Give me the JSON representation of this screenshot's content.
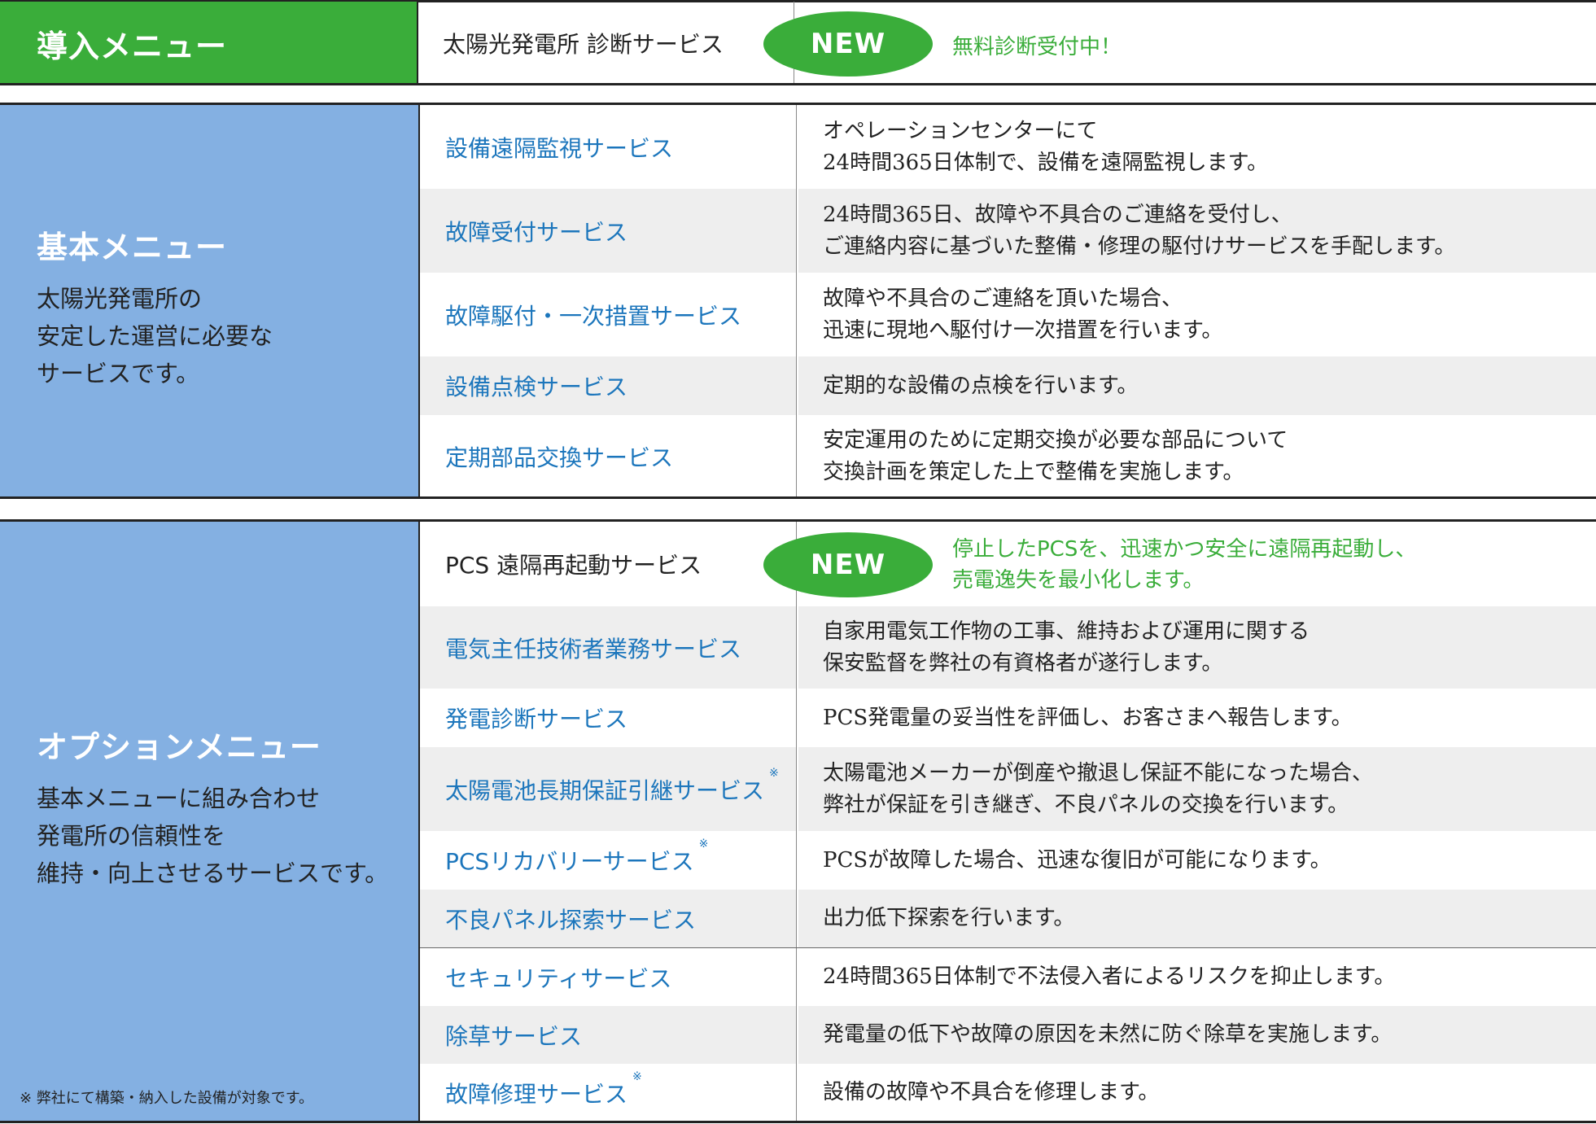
{
  "intro": {
    "label": "導入メニュー",
    "service": "太陽光発電所 診断サービス",
    "badge": "NEW",
    "note": "無料診断受付中！"
  },
  "basic": {
    "title": "基本メニュー",
    "desc": [
      "太陽光発電所の",
      "安定した運営に必要な",
      "サービスです。"
    ],
    "rows": [
      {
        "name": "設備遠隔監視サービス",
        "desc": [
          "オペレーションセンターにて",
          "24時間365日体制で、設備を遠隔監視します。"
        ]
      },
      {
        "name": "故障受付サービス",
        "desc": [
          "24時間365日、故障や不具合のご連絡を受付し、",
          "ご連絡内容に基づいた整備・修理の駆付けサービスを手配します。"
        ]
      },
      {
        "name": "故障駆付・一次措置サービス",
        "desc": [
          "故障や不具合のご連絡を頂いた場合、",
          "迅速に現地へ駆付け一次措置を行います。"
        ]
      },
      {
        "name": "設備点検サービス",
        "desc": [
          "定期的な設備の点検を行います。"
        ]
      },
      {
        "name": "定期部品交換サービス",
        "desc": [
          "安定運用のために定期交換が必要な部品について",
          "交換計画を策定した上で整備を実施します。"
        ]
      }
    ]
  },
  "option": {
    "title": "オプションメニュー",
    "desc": [
      "基本メニューに組み合わせ",
      "発電所の信頼性を",
      "維持・向上させるサービスです。"
    ],
    "footnote": "※ 弊社にて構築・納入した設備が対象です。",
    "pcs_restart": {
      "name": "PCS 遠隔再起動サービス",
      "badge": "NEW",
      "note": [
        "停止したPCSを、迅速かつ安全に遠隔再起動し、",
        "売電逸失を最小化します。"
      ]
    },
    "rows": [
      {
        "name": "電気主任技術者業務サービス",
        "mark": "",
        "desc": [
          "自家用電気工作物の工事、維持および運用に関する",
          "保安監督を弊社の有資格者が遂行します。"
        ]
      },
      {
        "name": "発電診断サービス",
        "mark": "",
        "desc": [
          "PCS発電量の妥当性を評価し、お客さまへ報告します。"
        ]
      },
      {
        "name": "太陽電池長期保証引継サービス",
        "mark": "※",
        "desc": [
          "太陽電池メーカーが倒産や撤退し保証不能になった場合、",
          "弊社が保証を引き継ぎ、不良パネルの交換を行います。"
        ]
      },
      {
        "name": "PCSリカバリーサービス",
        "mark": "※",
        "desc": [
          "PCSが故障した場合、迅速な復旧が可能になります。"
        ]
      },
      {
        "name": "不良パネル探索サービス",
        "mark": "",
        "desc": [
          "出力低下探索を行います。"
        ]
      },
      {
        "name": "セキュリティサービス",
        "mark": "",
        "desc": [
          "24時間365日体制で不法侵入者によるリスクを抑止します。"
        ]
      },
      {
        "name": "除草サービス",
        "mark": "",
        "desc": [
          "発電量の低下や故障の原因を未然に防ぐ除草を実施します。"
        ]
      },
      {
        "name": "故障修理サービス",
        "mark": "※",
        "desc": [
          "設備の故障や不具合を修理します。"
        ]
      }
    ]
  }
}
